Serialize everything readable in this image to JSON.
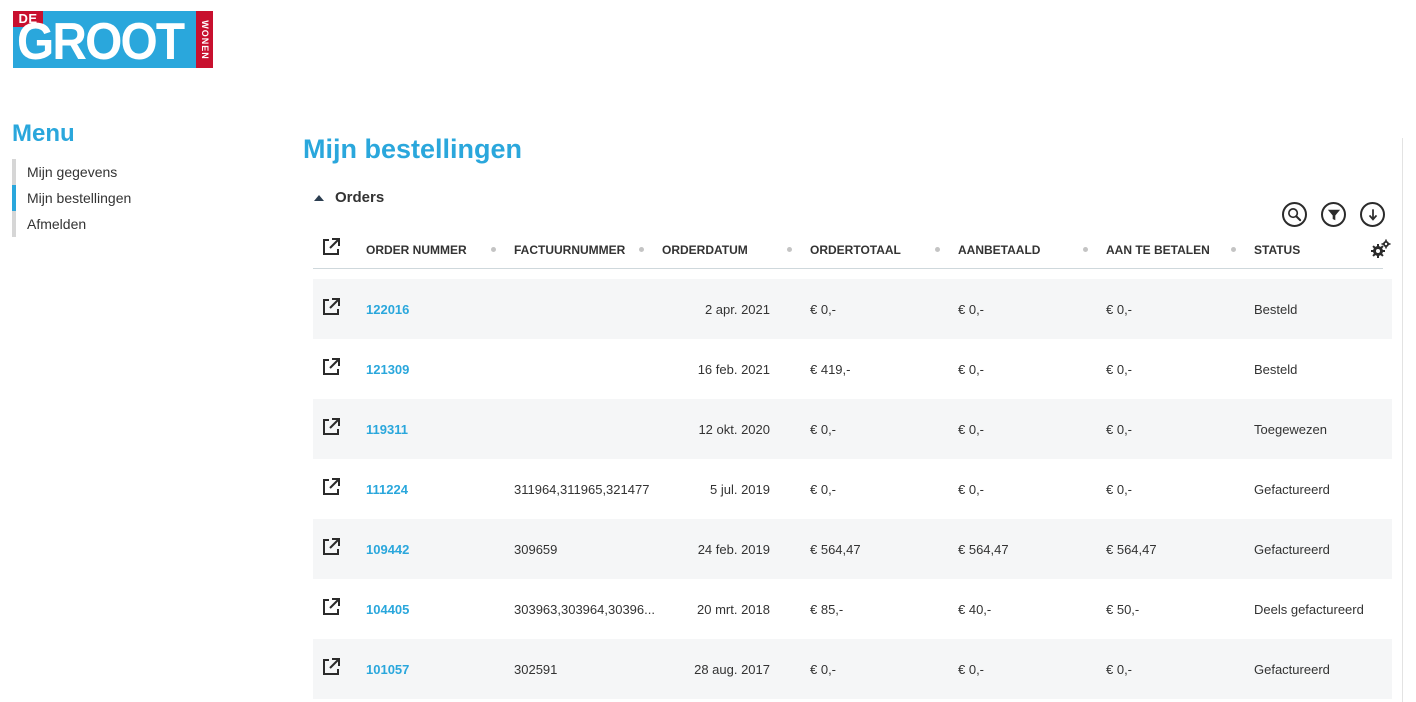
{
  "logo": {
    "de": "DE",
    "main": "GROOT",
    "side": "WONEN"
  },
  "menu": {
    "title": "Menu",
    "items": [
      {
        "label": "Mijn gegevens",
        "active": false
      },
      {
        "label": "Mijn bestellingen",
        "active": true
      },
      {
        "label": "Afmelden",
        "active": false
      }
    ]
  },
  "page": {
    "title": "Mijn bestellingen",
    "section": "Orders"
  },
  "toolbar": {
    "icons": [
      "search-icon",
      "filter-icon",
      "download-icon"
    ]
  },
  "table": {
    "columns": [
      "ORDER NUMMER",
      "FACTUURNUMMER",
      "ORDERDATUM",
      "ORDERTOTAAL",
      "AANBETAALD",
      "AAN TE BETALEN",
      "STATUS"
    ],
    "rows": [
      {
        "order": "122016",
        "factuur": "",
        "datum": "2 apr. 2021",
        "totaal": "€ 0,-",
        "aanbetaald": "€ 0,-",
        "te_betalen": "€ 0,-",
        "status": "Besteld"
      },
      {
        "order": "121309",
        "factuur": "",
        "datum": "16 feb. 2021",
        "totaal": "€ 419,-",
        "aanbetaald": "€ 0,-",
        "te_betalen": "€ 0,-",
        "status": "Besteld"
      },
      {
        "order": "119311",
        "factuur": "",
        "datum": "12 okt. 2020",
        "totaal": "€ 0,-",
        "aanbetaald": "€ 0,-",
        "te_betalen": "€ 0,-",
        "status": "Toegewezen"
      },
      {
        "order": "111224",
        "factuur": "311964,311965,321477",
        "datum": "5 jul. 2019",
        "totaal": "€ 0,-",
        "aanbetaald": "€ 0,-",
        "te_betalen": "€ 0,-",
        "status": "Gefactureerd"
      },
      {
        "order": "109442",
        "factuur": "309659",
        "datum": "24 feb. 2019",
        "totaal": "€ 564,47",
        "aanbetaald": "€ 564,47",
        "te_betalen": "€ 564,47",
        "status": "Gefactureerd"
      },
      {
        "order": "104405",
        "factuur": "303963,303964,30396...",
        "datum": "20 mrt. 2018",
        "totaal": "€ 85,-",
        "aanbetaald": "€ 40,-",
        "te_betalen": "€ 50,-",
        "status": "Deels gefactureerd"
      },
      {
        "order": "101057",
        "factuur": "302591",
        "datum": "28 aug. 2017",
        "totaal": "€ 0,-",
        "aanbetaald": "€ 0,-",
        "te_betalen": "€ 0,-",
        "status": "Gefactureerd"
      }
    ]
  },
  "colors": {
    "accent": "#2aa7dc",
    "brand_red": "#c8102e",
    "row_shade": "#f5f6f7"
  }
}
